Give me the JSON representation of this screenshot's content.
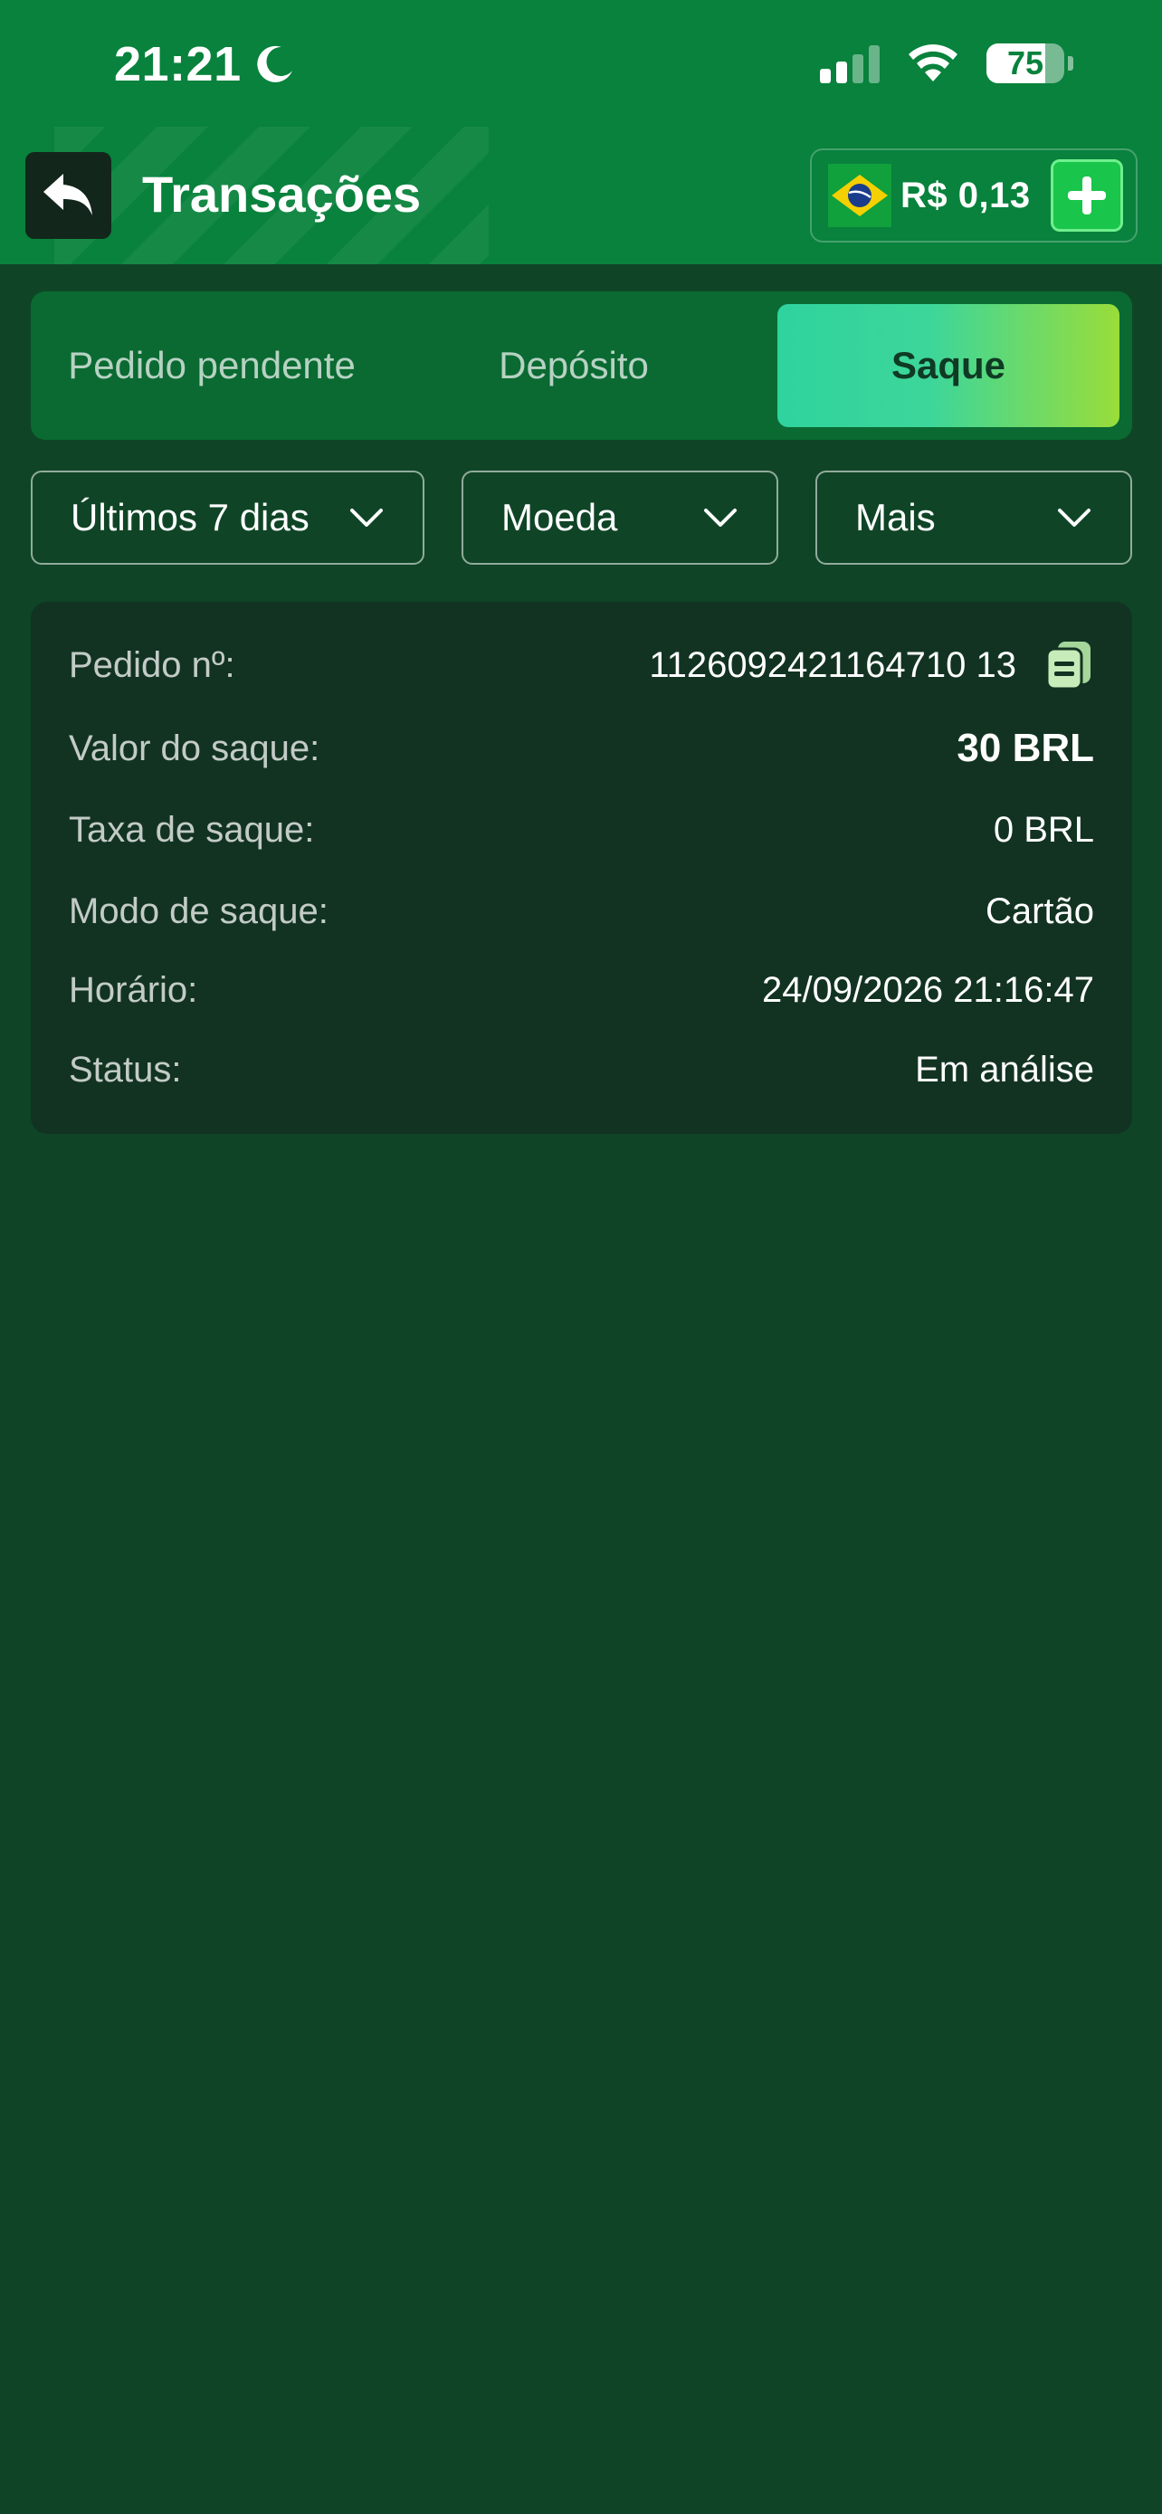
{
  "status_bar": {
    "time": "21:21",
    "battery_percent": "75",
    "battery_level": 0.75,
    "icons": [
      "moon-icon",
      "signal-icon",
      "wifi-icon",
      "battery-icon"
    ]
  },
  "header": {
    "title": "Transações",
    "back_icon": "back-arrow-icon",
    "balance": "R$ 0,13",
    "flag": "brazil-flag-icon",
    "add_icon": "plus-icon"
  },
  "tabs": [
    {
      "label": "Pedido pendente",
      "active": false
    },
    {
      "label": "Depósito",
      "active": false
    },
    {
      "label": "Saque",
      "active": true
    }
  ],
  "filters": [
    {
      "label": "Últimos 7 dias"
    },
    {
      "label": "Moeda"
    },
    {
      "label": "Mais"
    }
  ],
  "order": {
    "rows": [
      {
        "key": "Pedido nº:",
        "value": "1126092421164710 13"
      },
      {
        "key": "Valor do saque:",
        "value": "30 BRL"
      },
      {
        "key": "Taxa de saque:",
        "value": "0 BRL"
      },
      {
        "key": "Modo de saque:",
        "value": "Cartão"
      },
      {
        "key": "Horário:",
        "value": "24/09/2026 21:16:47"
      },
      {
        "key": "Status:",
        "value": "Em análise"
      }
    ]
  },
  "colors": {
    "header_bg": "#08823c",
    "page_bg": "#0f4526",
    "card_bg": "#123322",
    "active_tab_start": "#2fd39e",
    "active_tab_end": "#99dd3a",
    "add_button": "#19c54a"
  }
}
